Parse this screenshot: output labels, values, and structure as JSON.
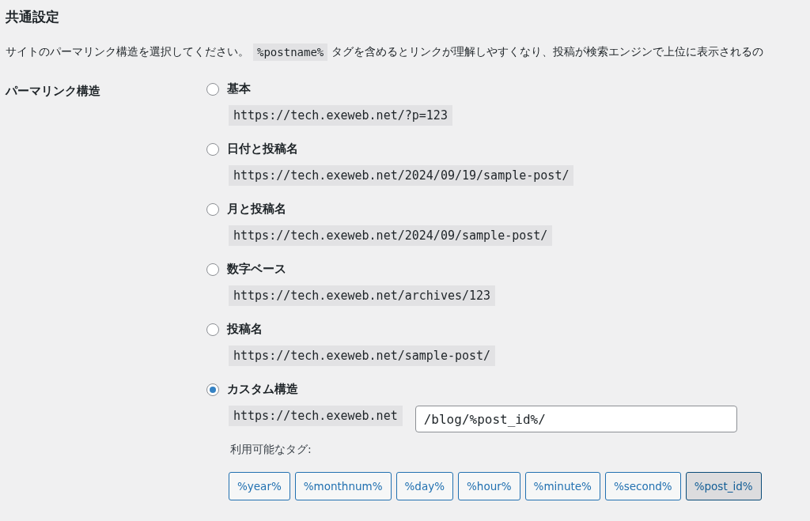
{
  "title": "共通設定",
  "description": {
    "before": "サイトのパーマリンク構造を選択してください。",
    "code": "%postname%",
    "after": "タグを含めるとリンクが理解しやすくなり、投稿が検索エンジンで上位に表示されるの"
  },
  "permalink_label": "パーマリンク構造",
  "options": [
    {
      "kind": "preset",
      "label": "基本",
      "example": "https://tech.exeweb.net/?p=123",
      "selected": false
    },
    {
      "kind": "preset",
      "label": "日付と投稿名",
      "example": "https://tech.exeweb.net/2024/09/19/sample-post/",
      "selected": false
    },
    {
      "kind": "preset",
      "label": "月と投稿名",
      "example": "https://tech.exeweb.net/2024/09/sample-post/",
      "selected": false
    },
    {
      "kind": "preset",
      "label": "数字ベース",
      "example": "https://tech.exeweb.net/archives/123",
      "selected": false
    },
    {
      "kind": "preset",
      "label": "投稿名",
      "example": "https://tech.exeweb.net/sample-post/",
      "selected": false
    },
    {
      "kind": "custom",
      "label": "カスタム構造",
      "prefix": "https://tech.exeweb.net",
      "value": "/blog/%post_id%/",
      "selected": true
    }
  ],
  "tags_label": "利用可能なタグ:",
  "tags": [
    {
      "label": "%year%",
      "selected": false
    },
    {
      "label": "%monthnum%",
      "selected": false
    },
    {
      "label": "%day%",
      "selected": false
    },
    {
      "label": "%hour%",
      "selected": false
    },
    {
      "label": "%minute%",
      "selected": false
    },
    {
      "label": "%second%",
      "selected": false
    },
    {
      "label": "%post_id%",
      "selected": true
    }
  ]
}
